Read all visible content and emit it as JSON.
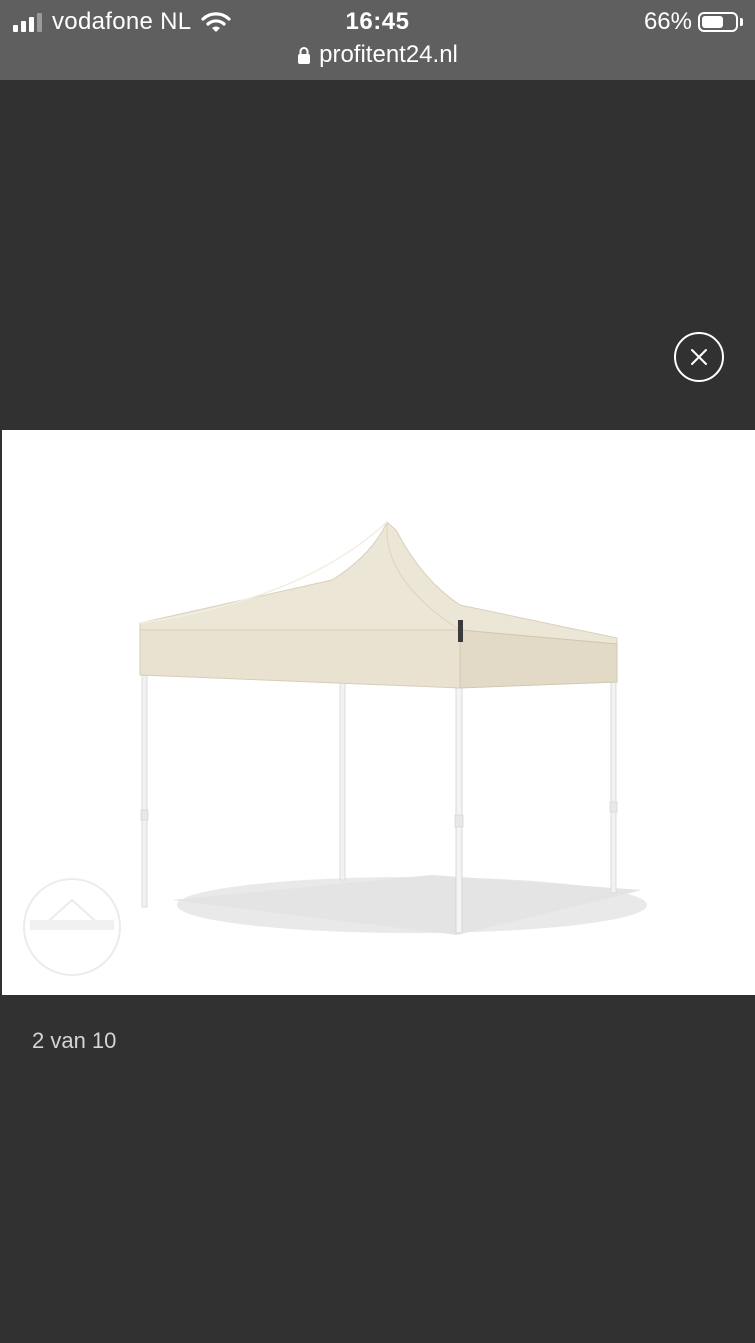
{
  "status_bar": {
    "carrier": "vodafone NL",
    "time": "16:45",
    "battery_percent": "66%",
    "battery_level": 0.66,
    "signal_bars_active": 3,
    "signal_bars_total": 4,
    "icons": [
      "signal-icon",
      "wifi-icon",
      "battery-icon"
    ]
  },
  "browser": {
    "url": "profitent24.nl",
    "secure_icon": "lock-icon"
  },
  "gallery": {
    "close_icon": "close-icon",
    "image_subject": "cream pop-up gazebo tent",
    "counter": "2 van 10",
    "current_index": 2,
    "total": 10
  },
  "colors": {
    "backdrop": "#313131",
    "status_bar": "#5f5f5f",
    "canopy": "#ece6d6",
    "frame": "#f4f4f4"
  }
}
